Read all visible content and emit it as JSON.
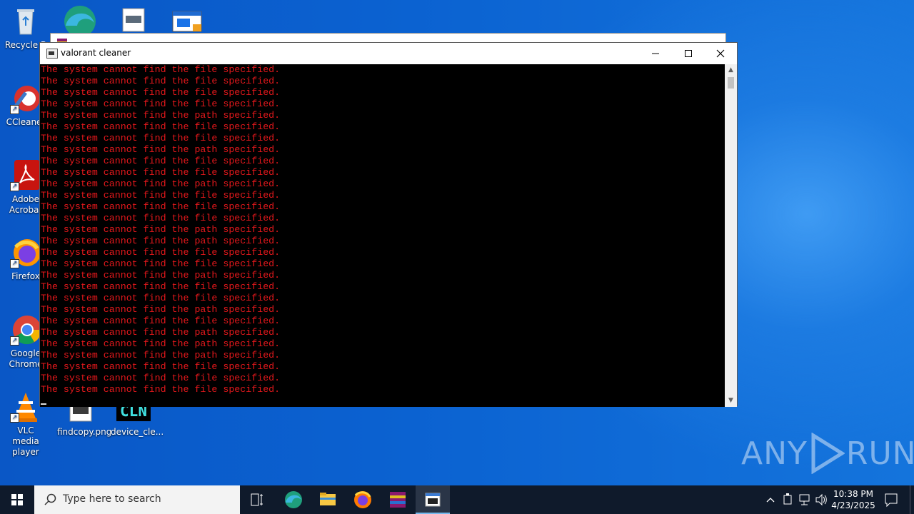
{
  "desktop": {
    "icons": [
      {
        "label": "Recycle B",
        "icon": "recycle-bin-icon"
      },
      {
        "label": "CCleaner",
        "icon": "ccleaner-icon"
      },
      {
        "label": "Adobe Acrobat",
        "icon": "adobe-acrobat-icon"
      },
      {
        "label": "Firefox",
        "icon": "firefox-icon"
      },
      {
        "label": "Google Chrome",
        "icon": "chrome-icon"
      },
      {
        "label": "VLC media player",
        "icon": "vlc-icon"
      },
      {
        "label": "findcopy.png",
        "icon": "image-file-icon"
      },
      {
        "label": "device_cle...",
        "icon": "cln-app-icon"
      }
    ],
    "cln_text": "CLN"
  },
  "console": {
    "title": "valorant cleaner",
    "minimize": "–",
    "maximize": "☐",
    "close": "✕",
    "lines": [
      "The system cannot find the file specified.",
      "The system cannot find the file specified.",
      "The system cannot find the file specified.",
      "The system cannot find the file specified.",
      "The system cannot find the path specified.",
      "The system cannot find the file specified.",
      "The system cannot find the file specified.",
      "The system cannot find the path specified.",
      "The system cannot find the file specified.",
      "The system cannot find the file specified.",
      "The system cannot find the path specified.",
      "The system cannot find the file specified.",
      "The system cannot find the file specified.",
      "The system cannot find the file specified.",
      "The system cannot find the path specified.",
      "The system cannot find the path specified.",
      "The system cannot find the file specified.",
      "The system cannot find the file specified.",
      "The system cannot find the path specified.",
      "The system cannot find the file specified.",
      "The system cannot find the file specified.",
      "The system cannot find the path specified.",
      "The system cannot find the file specified.",
      "The system cannot find the path specified.",
      "The system cannot find the path specified.",
      "The system cannot find the path specified.",
      "The system cannot find the file specified.",
      "The system cannot find the file specified.",
      "The system cannot find the file specified."
    ],
    "text_color": "#e6181c"
  },
  "watermark": {
    "left": "ANY",
    "right": "RUN"
  },
  "taskbar": {
    "search_placeholder": "Type here to search",
    "time": "10:38 PM",
    "date": "4/23/2025",
    "pinned": [
      "task-view-icon",
      "edge-icon",
      "file-explorer-icon",
      "firefox-icon",
      "winrar-icon",
      "console-icon"
    ],
    "accent": "#0f1a2b"
  }
}
